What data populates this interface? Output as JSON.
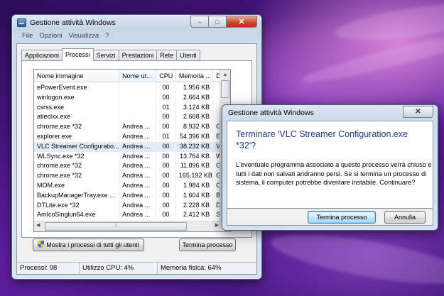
{
  "task_manager": {
    "title": "Gestione attività Windows",
    "window_controls": {
      "minimize": "–",
      "maximize": "□",
      "close": "✕"
    },
    "menu": [
      "File",
      "Opzioni",
      "Visualizza",
      "?"
    ],
    "tabs": [
      "Applicazioni",
      "Processi",
      "Servizi",
      "Prestazioni",
      "Rete",
      "Utenti"
    ],
    "active_tab": "Processi",
    "columns": [
      "Nome immagine",
      "Nome ut...",
      "CPU",
      "Memoria ...",
      "D"
    ],
    "rows": [
      {
        "name": "ePowerEvent.exe",
        "user": "",
        "cpu": "00",
        "mem": "1.956 KB",
        "desc": ""
      },
      {
        "name": "winlogon.exe",
        "user": "",
        "cpu": "00",
        "mem": "2.664 KB",
        "desc": ""
      },
      {
        "name": "csrss.exe",
        "user": "",
        "cpu": "01",
        "mem": "3.124 KB",
        "desc": ""
      },
      {
        "name": "atieclxx.exe",
        "user": "",
        "cpu": "00",
        "mem": "2.668 KB",
        "desc": ""
      },
      {
        "name": "chrome.exe *32",
        "user": "Andrea ...",
        "cpu": "00",
        "mem": "8.932 KB",
        "desc": "G"
      },
      {
        "name": "explorer.exe",
        "user": "Andrea ...",
        "cpu": "01",
        "mem": "54.396 KB",
        "desc": "E"
      },
      {
        "name": "VLC Streamer Configuratio...",
        "user": "Andrea ...",
        "cpu": "00",
        "mem": "38.232 KB",
        "desc": "V"
      },
      {
        "name": "WLSync.exe *32",
        "user": "Andrea ...",
        "cpu": "00",
        "mem": "13.764 KB",
        "desc": "W"
      },
      {
        "name": "chrome.exe *32",
        "user": "Andrea ...",
        "cpu": "00",
        "mem": "11.896 KB",
        "desc": "G"
      },
      {
        "name": "chrome.exe *32",
        "user": "Andrea ...",
        "cpu": "00",
        "mem": "165.192 KB",
        "desc": "G"
      },
      {
        "name": "MOM.exe",
        "user": "Andrea ...",
        "cpu": "00",
        "mem": "1.984 KB",
        "desc": "C"
      },
      {
        "name": "BackupManagerTray.exe ...",
        "user": "Andrea ...",
        "cpu": "00",
        "mem": "1.604 KB",
        "desc": "B"
      },
      {
        "name": "DTLite.exe *32",
        "user": "Andrea ...",
        "cpu": "00",
        "mem": "2.228 KB",
        "desc": "D"
      },
      {
        "name": "AmIcoSinglun64.exe",
        "user": "Andrea ...",
        "cpu": "00",
        "mem": "2.412 KB",
        "desc": "S"
      }
    ],
    "selected_row": 6,
    "show_all_button": "Mostra i processi di tutti gli utenti",
    "end_process_button": "Termina processo",
    "status": {
      "processes": "Processi: 98",
      "cpu": "Utilizzo CPU: 4%",
      "memory": "Memoria fisica: 64%"
    }
  },
  "dialog": {
    "title": "Gestione attività Windows",
    "close": "✕",
    "heading": "Terminare 'VLC Streamer Configuration.exe *32'?",
    "message": "L'eventuale programma associato a questo processo verrà chiuso e tutti i dati non salvati andranno persi. Se si termina un processo di sistema, il computer potrebbe diventare instabile. Continuare?",
    "confirm_button": "Termina processo",
    "cancel_button": "Annulla"
  }
}
